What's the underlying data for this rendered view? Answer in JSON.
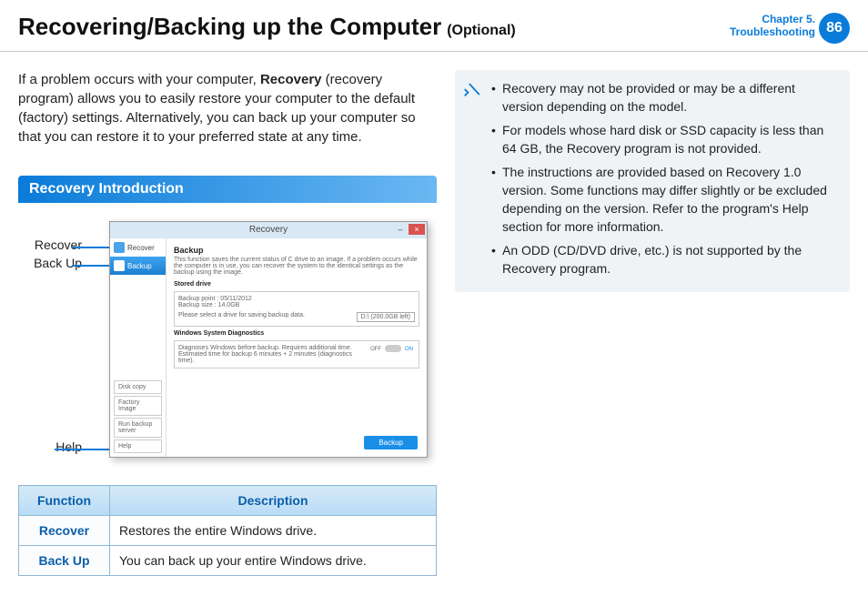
{
  "header": {
    "title": "Recovering/Backing up the Computer",
    "subtitle": "(Optional)",
    "chapter_line1": "Chapter 5.",
    "chapter_line2": "Troubleshooting",
    "page_number": "86"
  },
  "intro": {
    "before_bold": "If a problem occurs with your computer, ",
    "bold": "Recovery",
    "after_bold": " (recovery program) allows you to easily restore your computer to the default (factory) settings. Alternatively, you can back up your computer so that you can restore it to your preferred state at any time."
  },
  "section_heading": "Recovery Introduction",
  "callouts": {
    "recover": "Recover",
    "backup": "Back Up",
    "help": "Help"
  },
  "screenshot": {
    "window_title": "Recovery",
    "side_recover": "Recover",
    "side_backup": "Backup",
    "side_disk_copy": "Disk copy",
    "side_factory_image": "Factory Image",
    "side_run_backup_server": "Run backup server",
    "side_help": "Help",
    "main_heading": "Backup",
    "main_desc": "This function saves the current status of C drive to an image. If a problem occurs while the computer is in use, you can recover the system to the identical settings as the backup using the image.",
    "stored_drive_label": "Stored drive",
    "backup_point": "Backup point : 05/11/2012",
    "backup_size": "Backup size : 14.0GB",
    "select_drive": "Please select a drive for saving backup data.",
    "drive_value": "D:\\ (200.0GB left)",
    "diag_label": "Windows System Diagnostics",
    "diag_desc": "Diagnoses Windows before backup. Requires additional time. Estimated time for backup 6 minutes + 2 minutes (diagnostics time).",
    "off": "OFF",
    "on": "ON",
    "backup_button": "Backup"
  },
  "table": {
    "head_function": "Function",
    "head_description": "Description",
    "rows": [
      {
        "name": "Recover",
        "desc": "Restores the entire Windows drive."
      },
      {
        "name": "Back Up",
        "desc": "You can back up your entire Windows drive."
      }
    ]
  },
  "notes": [
    "Recovery may not be provided or may be a different version depending on the model.",
    "For models whose hard disk or SSD capacity is less than 64 GB, the Recovery program is not provided.",
    "The instructions are provided based on Recovery 1.0 version. Some functions may differ slightly or be excluded depending on the version. Refer to the program's Help section for more information.",
    "An ODD (CD/DVD drive, etc.) is not supported by the Recovery program."
  ]
}
